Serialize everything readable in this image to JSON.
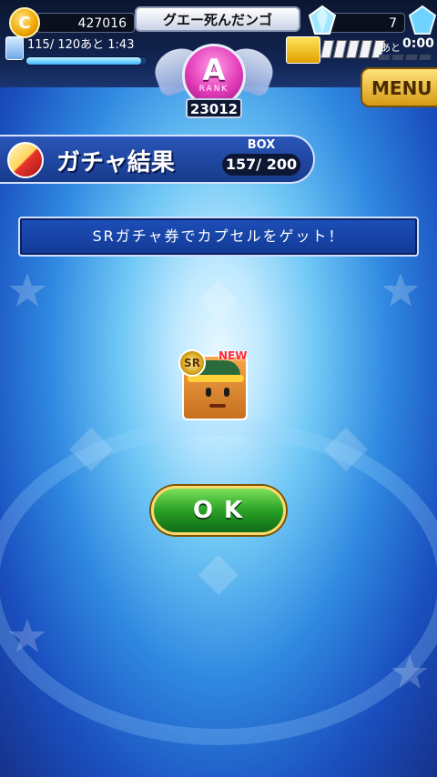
{
  "header": {
    "coins": "427016",
    "player_name": "グエー死んだンゴ",
    "gems": "7",
    "stamina": "115/ 120あと 1:43",
    "stamina_ratio": 0.958,
    "ticket_prefix": "あと",
    "ticket_timer": "0:00",
    "rank_letter": "A",
    "rank_label": "RANK",
    "rank_value": "23012",
    "menu_label": "MENU"
  },
  "result": {
    "title": "ガチャ結果",
    "box_label": "BOX",
    "box_value": "157/ 200",
    "message": "SRガチャ券でカプセルをゲット！",
    "item_rarity": "SR",
    "item_new": "NEW",
    "ok_label": "OK"
  },
  "icons": [
    "coin-icon",
    "gem-icon",
    "stamina-icon",
    "ticket-icon",
    "capsule-icon",
    "rank-badge-icon"
  ]
}
